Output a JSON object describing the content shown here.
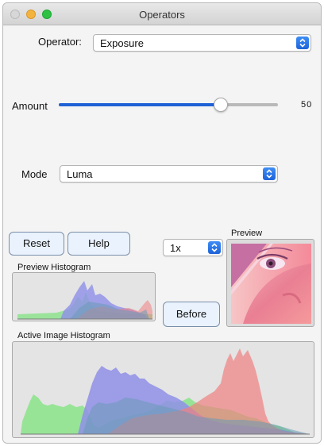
{
  "window": {
    "title": "Operators"
  },
  "operator": {
    "label": "Operator:",
    "value": "Exposure"
  },
  "amount": {
    "label": "Amount",
    "value": "50",
    "level": 0.8
  },
  "mode": {
    "label": "Mode",
    "value": "Luma"
  },
  "buttons": {
    "reset": "Reset",
    "help": "Help",
    "before": "Before"
  },
  "zoom": {
    "value": "1x"
  },
  "preview": {
    "label": "Preview"
  },
  "preview_histogram": {
    "label": "Preview Histogram"
  },
  "active_histogram": {
    "label": "Active Image Histogram"
  },
  "colors": {
    "accent": "#1f62d6",
    "red": "#f08080",
    "green": "#8ee38e",
    "blue": "#8f8fe8"
  },
  "icons": [
    "chevron-updown-icon",
    "chevron-updown-icon",
    "chevron-updown-icon"
  ]
}
